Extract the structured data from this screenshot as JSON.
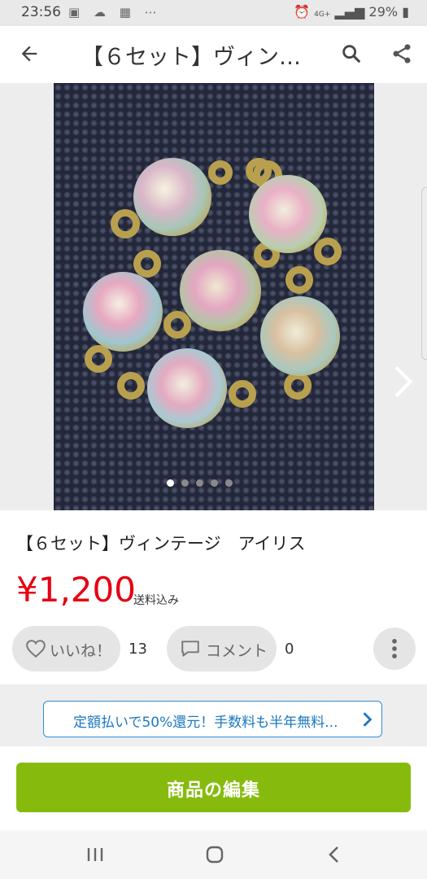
{
  "status_bar": {
    "time": "23:56",
    "battery": "29%",
    "network": "4G+"
  },
  "app_bar": {
    "title": "【６セット】ヴィンテ…",
    "back_icon": "arrow-left-icon",
    "search_icon": "search-icon",
    "share_icon": "share-icon"
  },
  "gallery": {
    "image_description_icon": "product-photo",
    "page_count": 5,
    "active_page": 1
  },
  "product": {
    "title": "【６セット】ヴィンテージ　アイリス",
    "price": "¥1,200",
    "shipping": "送料込み"
  },
  "actions": {
    "like_label": "いいね！",
    "like_count": "13",
    "comment_label": "コメント",
    "comment_count": "0"
  },
  "promo": {
    "text": "定額払いで50%還元！手数料も半年無料..."
  },
  "edit": {
    "label": "商品の編集"
  },
  "colors": {
    "price": "#e60012",
    "edit_button": "#86bb0d",
    "promo_border": "#2b8fd8"
  }
}
